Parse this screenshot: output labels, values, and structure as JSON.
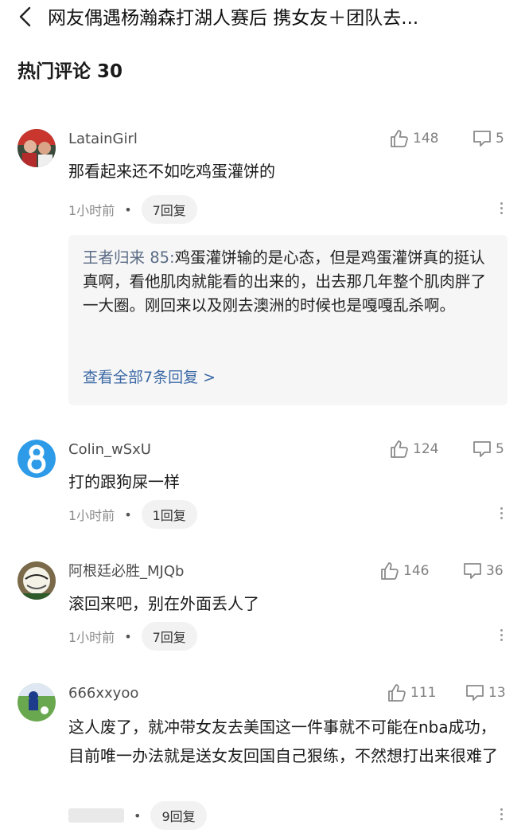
{
  "header": {
    "title": "网友偶遇杨瀚森打湖人赛后 携女友＋团队去..."
  },
  "section": {
    "title": "热门评论 30"
  },
  "comments": [
    {
      "user": "LatainGirl",
      "likes": "148",
      "replies_count": "5",
      "text": "那看起来还不如吃鸡蛋灌饼的",
      "time": "1小时前",
      "reply_pill": "7回复",
      "sub": {
        "user": "王者归来 85:",
        "text": "鸡蛋灌饼输的是心态，但是鸡蛋灌饼真的挺认真啊，看他肌肉就能看的出来的，出去那几年整个肌肉胖了一大圈。刚回来以及刚去澳洲的时候也是嘎嘎乱杀啊。",
        "more": "查看全部7条回复 >"
      }
    },
    {
      "user": "Colin_wSxU",
      "likes": "124",
      "replies_count": "5",
      "text": "打的跟狗屎一样",
      "time": "1小时前",
      "reply_pill": "1回复"
    },
    {
      "user": "阿根廷必胜_MJQb",
      "likes": "146",
      "replies_count": "36",
      "text": "滚回来吧，别在外面丢人了",
      "time": "1小时前",
      "reply_pill": "7回复"
    },
    {
      "user": "666xxyoo",
      "likes": "111",
      "replies_count": "13",
      "text": "这人废了，就冲带女友去美国这一件事就不可能在nba成功，目前唯一办法就是送女友回国自己狠练，不然想打出来很难了",
      "time": "",
      "reply_pill": "9回复"
    }
  ],
  "meta_dot": "•",
  "icons": {
    "back": "chevron-left-icon",
    "like": "thumbs-up-icon",
    "reply": "reply-bubble-icon",
    "more": "more-vertical-icon"
  },
  "colors": {
    "accent_link": "#3d6aa6",
    "sub_user": "#5a6b85",
    "avatar_blue": "#2d9be8"
  }
}
